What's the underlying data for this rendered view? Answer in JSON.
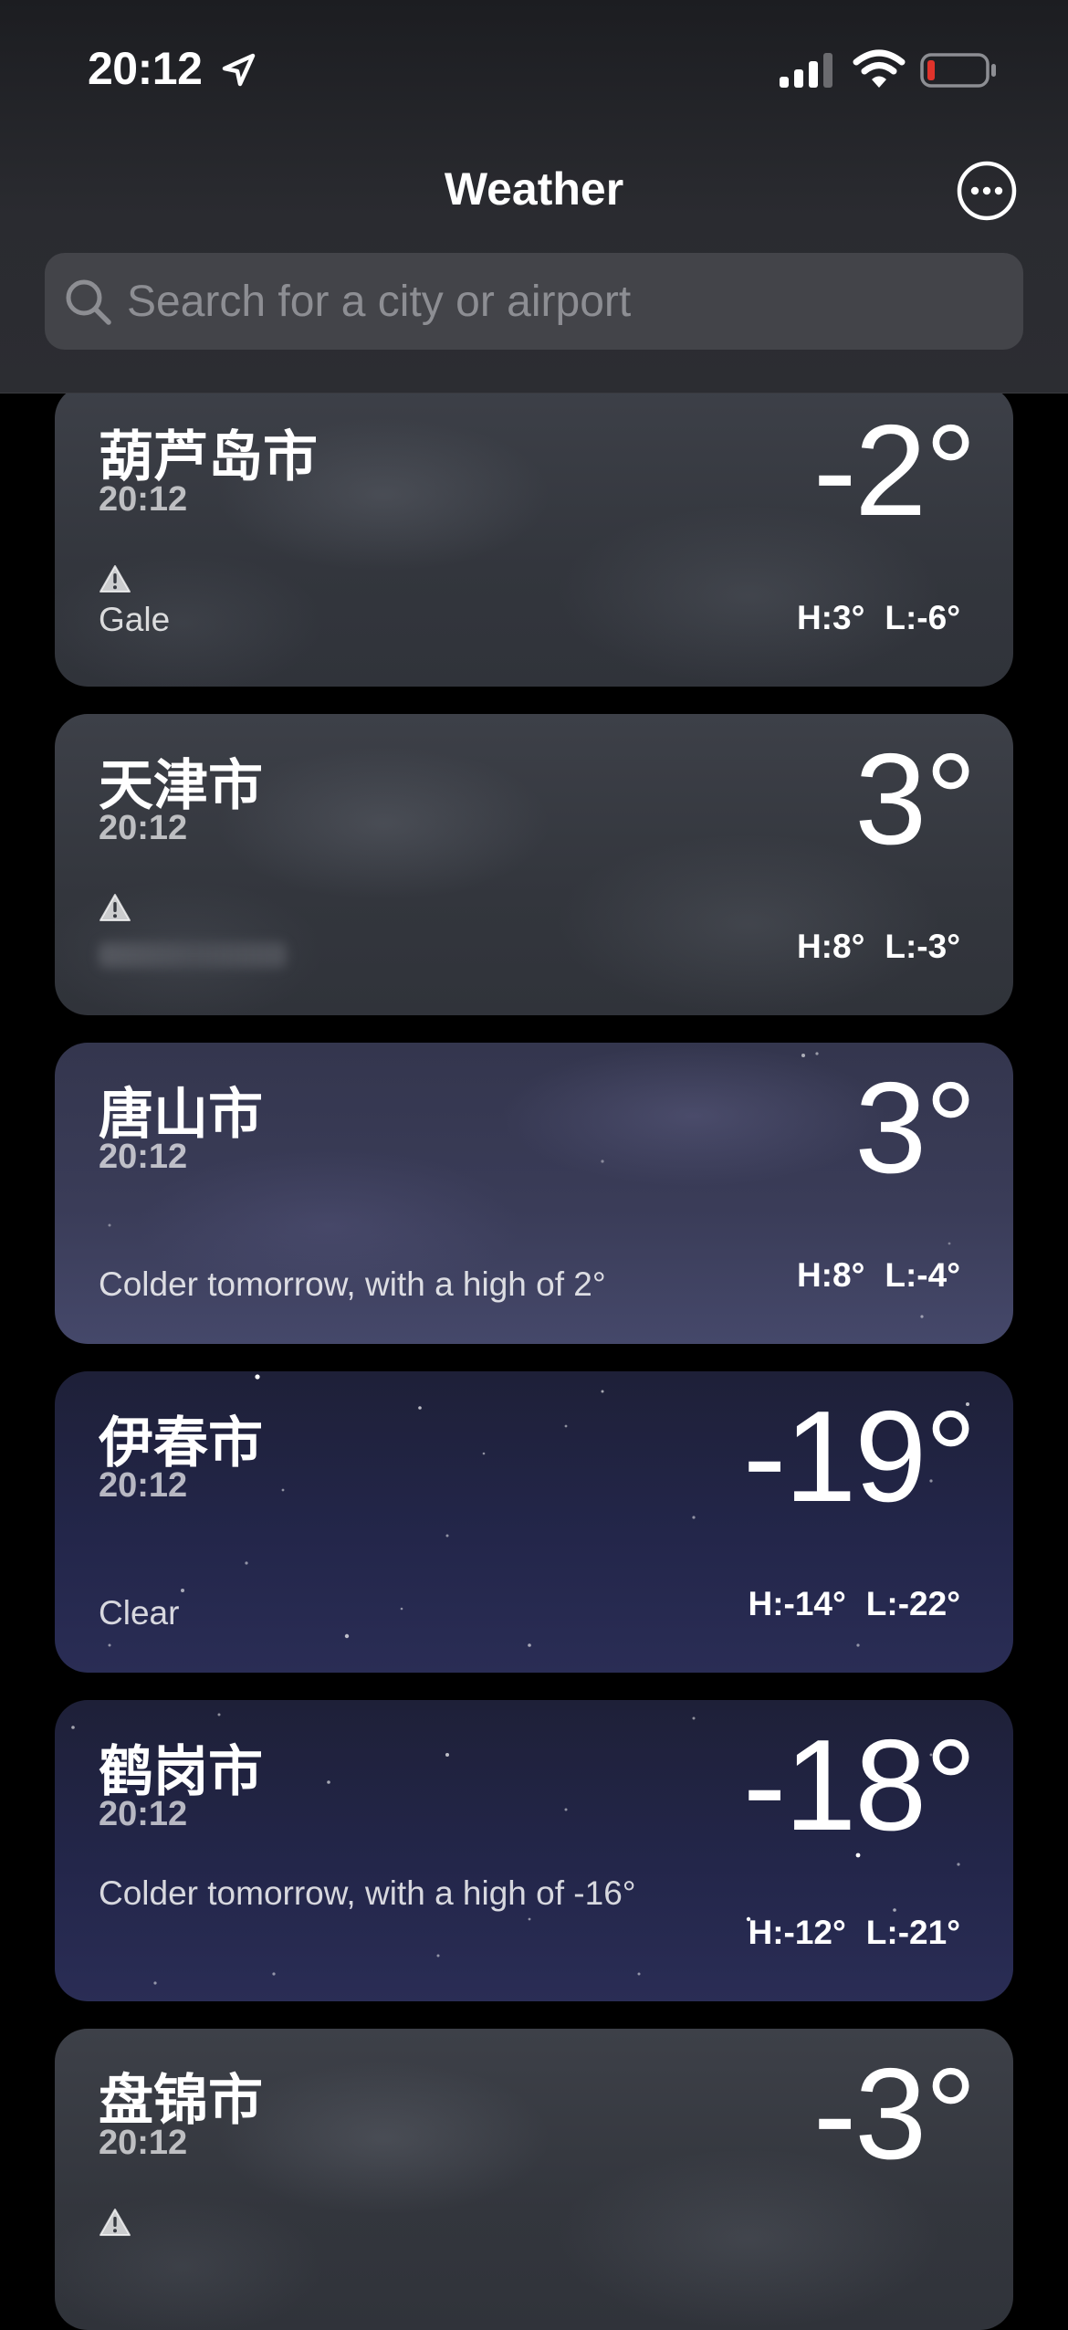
{
  "status_bar": {
    "time": "20:12",
    "icons": [
      "location-arrow-icon",
      "cellular-signal-icon",
      "wifi-icon",
      "battery-low-icon"
    ]
  },
  "header": {
    "title": "Weather",
    "more_icon": "ellipsis-circle-icon"
  },
  "search": {
    "placeholder": "Search for a city or airport",
    "icon": "search-icon"
  },
  "cards": [
    {
      "city": "葫芦岛市",
      "time": "20:12",
      "temp": "-2°",
      "condition": "Gale",
      "alert": true,
      "high": "H:3°",
      "low": "L:-6°"
    },
    {
      "city": "天津市",
      "time": "20:12",
      "temp": "3°",
      "condition": "",
      "alert": true,
      "high": "H:8°",
      "low": "L:-3°"
    },
    {
      "city": "唐山市",
      "time": "20:12",
      "temp": "3°",
      "condition": "Colder tomorrow, with a high of 2°",
      "alert": false,
      "high": "H:8°",
      "low": "L:-4°"
    },
    {
      "city": "伊春市",
      "time": "20:12",
      "temp": "-19°",
      "condition": "Clear",
      "alert": false,
      "high": "H:-14°",
      "low": "L:-22°"
    },
    {
      "city": "鹤岗市",
      "time": "20:12",
      "temp": "-18°",
      "condition": "Colder tomorrow, with a high of -16°",
      "alert": false,
      "high": "H:-12°",
      "low": "L:-21°"
    },
    {
      "city": "盘锦市",
      "time": "20:12",
      "temp": "-3°",
      "condition": "",
      "alert": true,
      "high": "",
      "low": ""
    }
  ],
  "colors": {
    "background": "#000000",
    "header_bg": "#2a2b30",
    "search_bg": "#434449",
    "card_cloudy": "#363940",
    "card_night_clear": "#23264a",
    "card_night_cloudy": "#3a3c58"
  }
}
